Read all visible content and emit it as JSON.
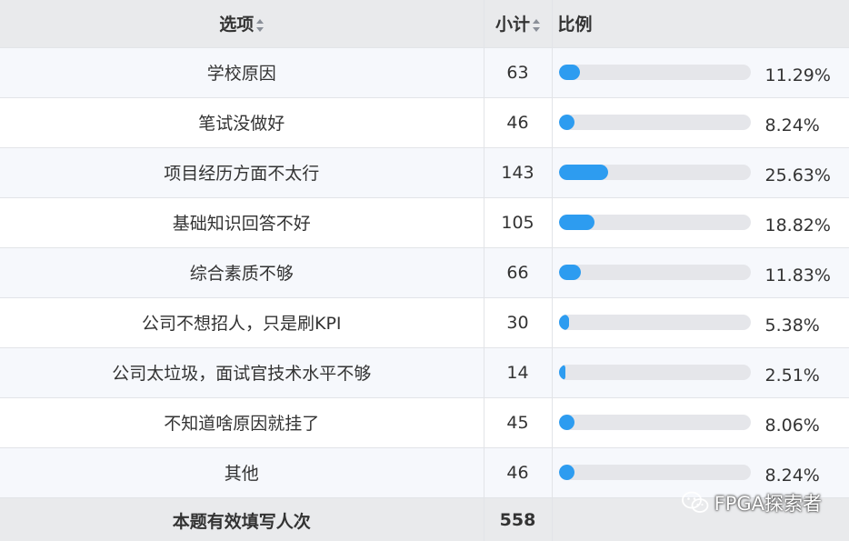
{
  "header": {
    "option_label": "选项",
    "count_label": "小计",
    "ratio_label": "比例",
    "sort_icon": "sort-icon",
    "accent_color": "#2d9cf0"
  },
  "rows": [
    {
      "option": "学校原因",
      "count": "63",
      "percent": "11.29%",
      "fraction": 0.1129
    },
    {
      "option": "笔试没做好",
      "count": "46",
      "percent": "8.24%",
      "fraction": 0.0824
    },
    {
      "option": "项目经历方面不太行",
      "count": "143",
      "percent": "25.63%",
      "fraction": 0.2563
    },
    {
      "option": "基础知识回答不好",
      "count": "105",
      "percent": "18.82%",
      "fraction": 0.1882
    },
    {
      "option": "综合素质不够",
      "count": "66",
      "percent": "11.83%",
      "fraction": 0.1183
    },
    {
      "option": "公司不想招人，只是刷KPI",
      "count": "30",
      "percent": "5.38%",
      "fraction": 0.0538
    },
    {
      "option": "公司太垃圾，面试官技术水平不够",
      "count": "14",
      "percent": "2.51%",
      "fraction": 0.0251
    },
    {
      "option": "不知道啥原因就挂了",
      "count": "45",
      "percent": "8.06%",
      "fraction": 0.0806
    },
    {
      "option": "其他",
      "count": "46",
      "percent": "8.24%",
      "fraction": 0.0824
    }
  ],
  "footer": {
    "label": "本题有效填写人次",
    "total": "558"
  },
  "watermark": {
    "icon": "wechat-icon",
    "text": "FPGA探索者"
  }
}
